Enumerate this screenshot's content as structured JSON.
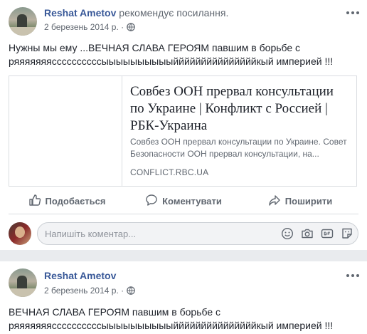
{
  "posts": [
    {
      "author": "Reshat Ametov",
      "action": "рекомендує посилання.",
      "date": "2 березень 2014 р. ·",
      "text": "Нужны мы ему ...ВЕЧНАЯ СЛАВА ГЕРОЯМ павшим в борьбе с ряяяяяяяссссссссссыыыыыыыыыыйййййййййййййййкый империей !!!",
      "link": {
        "title": "Совбез ООН прервал консультации по Украине | Конфликт с Россией | РБК-Украина",
        "description": "Совбез ООН прервал консультации по Украине. Совет Безопасности ООН прервал консультации, на...",
        "domain": "CONFLICT.RBC.UA"
      }
    },
    {
      "author": "Reshat Ametov",
      "date": "2 березень 2014 р. ·",
      "text": "ВЕЧНАЯ СЛАВА ГЕРОЯМ павшим в борьбе с ряяяяяяяссссссссссыыыыыыыыыыйййййййййййййййкый империей !!!"
    }
  ],
  "actions": {
    "like": "Подобається",
    "comment": "Коментувати",
    "share": "Поширити"
  },
  "comment_box": {
    "placeholder": "Напишіть коментар..."
  },
  "icons": {
    "more": "more-horizontal-icon",
    "audience": "globe-icon",
    "like": "thumbs-up-icon",
    "comment": "speech-bubble-icon",
    "share": "share-arrow-icon",
    "emoji": "smiley-icon",
    "camera": "camera-icon",
    "gif": "gif-icon",
    "sticker": "sticker-icon"
  },
  "colors": {
    "author": "#385898",
    "secondary_text": "#606770",
    "feed_background": "#e9ebee"
  }
}
